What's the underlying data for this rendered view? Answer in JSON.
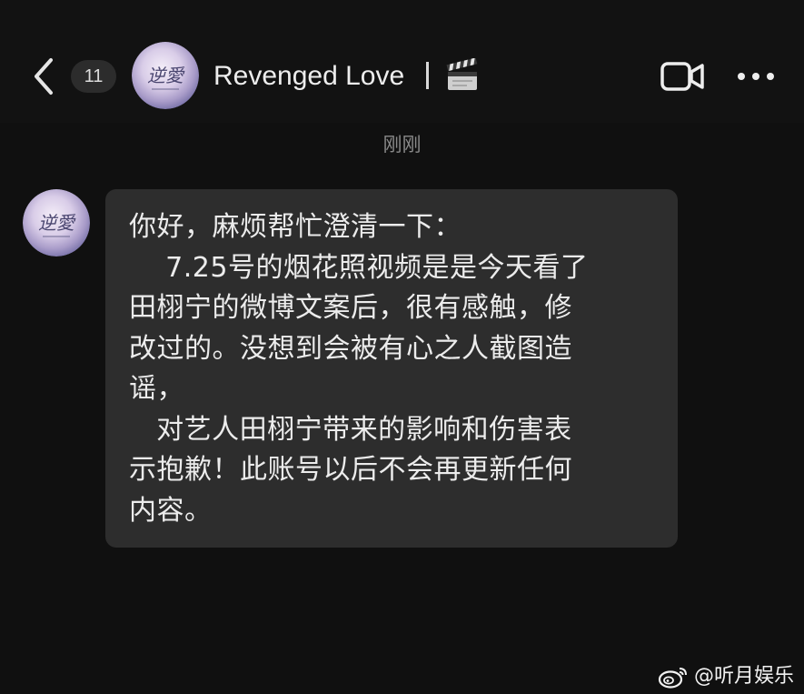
{
  "header": {
    "back_icon": "chevron-left-icon",
    "unread_count": "11",
    "contact_name": "Revenged Love",
    "avatar_text": "逆愛",
    "status_icon": "clapperboard-icon",
    "video_call_icon": "video-camera-icon",
    "more_icon": "more-dots-icon"
  },
  "conversation": {
    "timestamp": "刚刚",
    "message": {
      "sender_avatar_text": "逆愛",
      "lines": [
        "你好，麻烦帮忙澄清一下：",
        "    7.25号的烟花照视频是是今天看了",
        "田栩宁的微博文案后，很有感触，修",
        "改过的。没想到会被有心之人截图造",
        "谣，",
        "   对艺人田栩宁带来的影响和伤害表",
        "示抱歉！此账号以后不会再更新任何",
        "内容。"
      ]
    }
  },
  "watermark": {
    "logo_icon": "weibo-logo-icon",
    "text": "@听月娱乐"
  },
  "colors": {
    "background": "#101010",
    "bubble": "#2d2d2d",
    "text": "#ececec",
    "timestamp": "#8a8a8a"
  }
}
